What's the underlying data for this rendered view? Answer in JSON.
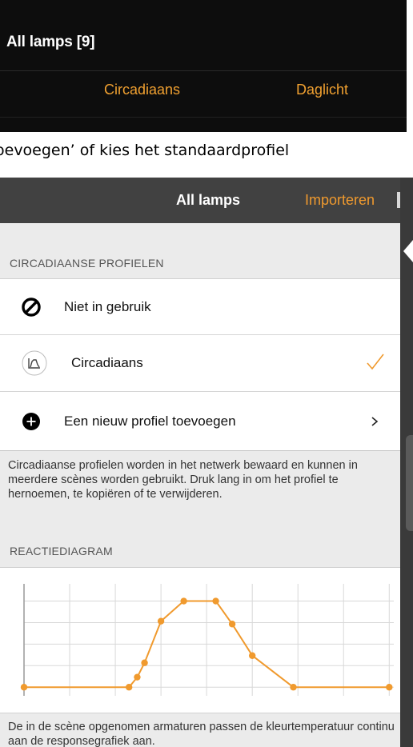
{
  "top": {
    "title": "All lamps [9]",
    "tabs": [
      "Circadiaans",
      "Daglicht"
    ]
  },
  "caption": "oevoegen’ of kies het standaardprofiel",
  "app_bar": {
    "title": "All lamps",
    "action": "Importeren"
  },
  "sections": {
    "profiles_header": "CIRCADIAANSE PROFIELEN",
    "diagram_header": "REACTIEDIAGRAM"
  },
  "profiles": [
    {
      "label": "Niet in gebruik",
      "icon": "not-in-use-icon",
      "selected": false
    },
    {
      "label": "Circadiaans",
      "icon": "circadian-curve-icon",
      "selected": true
    },
    {
      "label": "Een nieuw profiel toevoegen",
      "icon": "add-circle-icon",
      "selected": false
    }
  ],
  "info_text": "Circadiaanse profielen worden in het netwerk bewaard en kunnen in meerdere scènes worden gebruikt. Druk lang in om het profiel te hernoemen, te kopiëren of te verwijderen.",
  "footer_text": "De in de scène opgenomen armaturen passen de kleurtemperatuur continu aan de responsegrafiek aan.",
  "colors": {
    "accent": "#f09a2e",
    "app_bar": "#414141",
    "background": "#ebebeb"
  },
  "chart_data": {
    "type": "line",
    "x": [
      0,
      5.75,
      6.2,
      6.6,
      7.5,
      8.75,
      10.5,
      11.4,
      12.5,
      14.75,
      20.0
    ],
    "y": [
      0,
      0,
      0.35,
      0.85,
      2.3,
      3.0,
      3.0,
      2.2,
      1.1,
      0,
      0
    ],
    "xlim": [
      0,
      20.25
    ],
    "ylim": [
      -0.3,
      3.6
    ],
    "grid": true,
    "title": "",
    "xlabel": "",
    "ylabel": ""
  }
}
